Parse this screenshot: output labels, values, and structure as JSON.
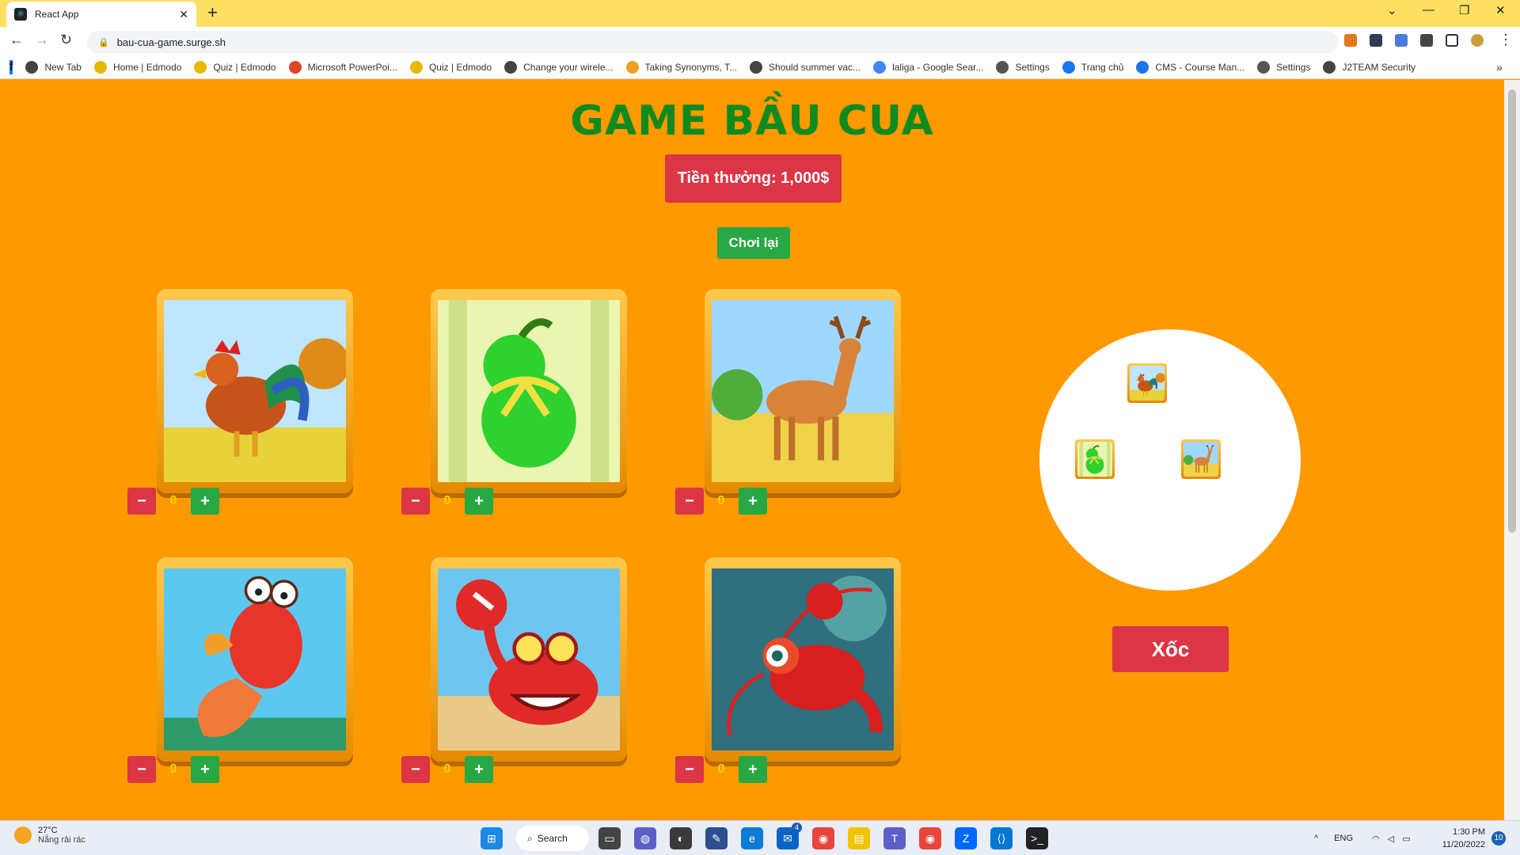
{
  "browser": {
    "tab_title": "React App",
    "tab_close": "✕",
    "new_tab": "+",
    "url": "bau-cua-game.surge.sh",
    "bookmarks": [
      {
        "label": "New Tab",
        "color": "#444444"
      },
      {
        "label": "Home | Edmodo",
        "color": "#e6b800"
      },
      {
        "label": "Quiz | Edmodo",
        "color": "#e6b800"
      },
      {
        "label": "Microsoft PowerPoi...",
        "color": "#e0451f"
      },
      {
        "label": "Quiz | Edmodo",
        "color": "#e6b800"
      },
      {
        "label": "Change your wirele...",
        "color": "#444444"
      },
      {
        "label": "Taking Synonyms, T...",
        "color": "#f0a020"
      },
      {
        "label": "Should summer vac...",
        "color": "#444444"
      },
      {
        "label": "laliga - Google Sear...",
        "color": "#4285f4"
      },
      {
        "label": "Settings",
        "color": "#555555"
      },
      {
        "label": "Trang chủ",
        "color": "#1877f2"
      },
      {
        "label": "CMS - Course Man...",
        "color": "#1a73e8"
      },
      {
        "label": "Settings",
        "color": "#555555"
      },
      {
        "label": "J2TEAM Security",
        "color": "#444444"
      }
    ],
    "bookmarks_more": "»"
  },
  "game": {
    "title": "GAME BẦU CUA",
    "reward": "Tiền thưởng: 1,000$",
    "replay": "Chơi lại",
    "shake": "Xốc",
    "items": [
      {
        "name": "ga",
        "icon": "rooster",
        "count": "0",
        "minus": "−",
        "plus": "+"
      },
      {
        "name": "bau",
        "icon": "gourd",
        "count": "0",
        "minus": "−",
        "plus": "+"
      },
      {
        "name": "nai",
        "icon": "deer",
        "count": "0",
        "minus": "−",
        "plus": "+"
      },
      {
        "name": "ca",
        "icon": "fish",
        "count": "0",
        "minus": "−",
        "plus": "+"
      },
      {
        "name": "cua",
        "icon": "crab",
        "count": "0",
        "minus": "−",
        "plus": "+"
      },
      {
        "name": "tom",
        "icon": "lobster",
        "count": "0",
        "minus": "−",
        "plus": "+"
      }
    ],
    "dice": [
      "rooster",
      "gourd",
      "deer"
    ]
  },
  "taskbar": {
    "temp": "27°C",
    "weather": "Nắng rải rác",
    "search": "Search",
    "lang": "ENG",
    "time": "1:30 PM",
    "date": "11/20/2022",
    "notifications": "10",
    "mail_badge": "4"
  },
  "colors": {
    "page_bg": "#ff9900",
    "title_green": "#0f8a1f",
    "danger": "#dc3545",
    "success": "#28a745"
  }
}
